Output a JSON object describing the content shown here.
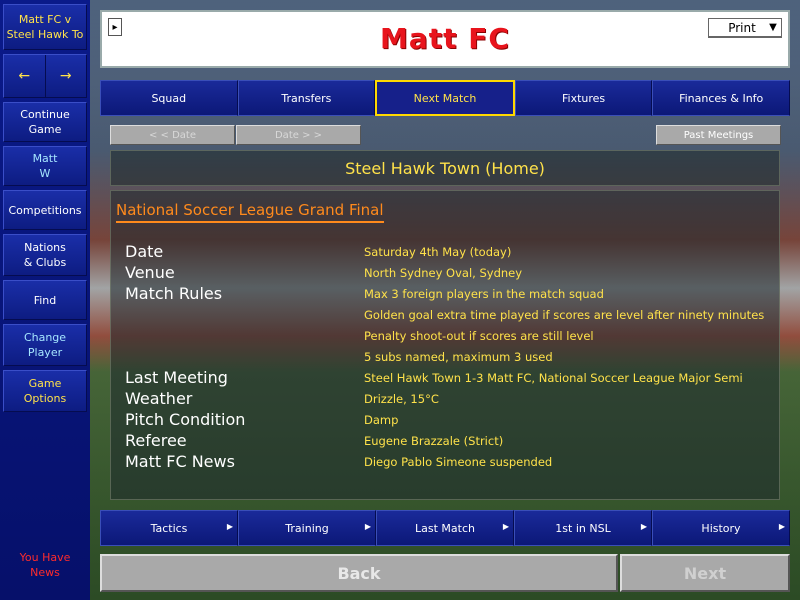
{
  "sidebar": {
    "match": "Matt FC v\nSteel Hawk To",
    "back_arrow": "←",
    "forward_arrow": "→",
    "continue": "Continue\nGame",
    "manager": "Matt\nW",
    "competitions": "Competitions",
    "nations": "Nations\n& Clubs",
    "find": "Find",
    "change_player": "Change\nPlayer",
    "game_options": "Game\nOptions",
    "news": "You Have\nNews"
  },
  "header": {
    "title": "Matt FC",
    "print": "Print",
    "arrow": "▸"
  },
  "tabs": [
    {
      "label": "Squad"
    },
    {
      "label": "Transfers"
    },
    {
      "label": "Next Match"
    },
    {
      "label": "Fixtures"
    },
    {
      "label": "Finances & Info"
    }
  ],
  "date_nav": {
    "prev": "< < Date",
    "next": "Date > >",
    "past_meetings": "Past Meetings"
  },
  "opponent": "Steel Hawk Town (Home)",
  "competition": "National Soccer League Grand Final",
  "info": {
    "date_label": "Date",
    "date_value": "Saturday 4th May (today)",
    "venue_label": "Venue",
    "venue_value": "North Sydney Oval, Sydney",
    "rules_label": "Match Rules",
    "rules": [
      "Max 3 foreign players in the match squad",
      "Golden goal extra time played if scores are level after ninety minutes",
      "Penalty shoot-out if scores are still level",
      "5 subs named, maximum 3 used"
    ],
    "last_meeting_label": "Last Meeting",
    "last_meeting_value": "Steel Hawk Town 1-3 Matt FC, National Soccer League Major Semi",
    "weather_label": "Weather",
    "weather_value": "Drizzle, 15°C",
    "pitch_label": "Pitch Condition",
    "pitch_value": "Damp",
    "referee_label": "Referee",
    "referee_value": "Eugene Brazzale (Strict)",
    "news_label": "Matt FC News",
    "news_value": "Diego Pablo Simeone suspended"
  },
  "bottom_tabs": [
    {
      "label": "Tactics"
    },
    {
      "label": "Training"
    },
    {
      "label": "Last Match"
    },
    {
      "label": "1st in NSL"
    },
    {
      "label": "History"
    }
  ],
  "footer": {
    "back": "Back",
    "next": "Next"
  },
  "colors": {
    "accent_yellow": "#ffe24a",
    "title_red": "#e8141c",
    "competition_orange": "#ff8a1c"
  }
}
